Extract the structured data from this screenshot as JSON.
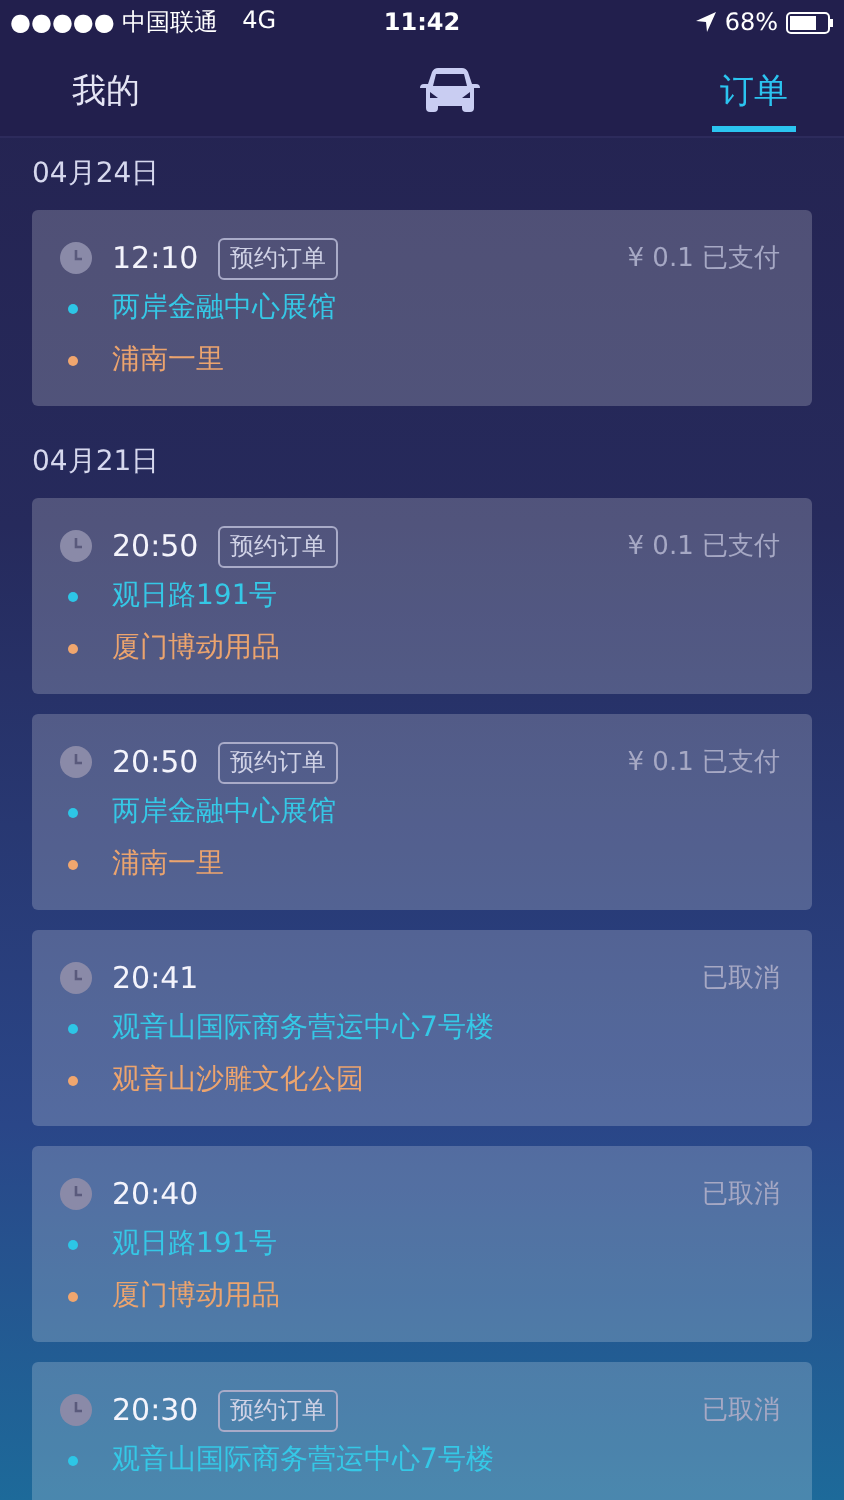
{
  "status_bar": {
    "carrier": "●●●●● 中国联通",
    "network": "4G",
    "time": "11:42",
    "battery": "68%"
  },
  "tabs": [
    {
      "label": "我的",
      "kind": "text",
      "selected": false
    },
    {
      "kind": "car",
      "selected": false
    },
    {
      "label": "订单",
      "kind": "text",
      "selected": true
    }
  ],
  "groups": [
    {
      "date": "04月24日",
      "orders": [
        {
          "time": "12:10",
          "reserved": true,
          "badge": "预约订单",
          "status": "¥ 0.1 已支付",
          "from": "两岸金融中心展馆",
          "to": "浦南一里"
        }
      ]
    },
    {
      "date": "04月21日",
      "orders": [
        {
          "time": "20:50",
          "reserved": true,
          "badge": "预约订单",
          "status": "¥ 0.1 已支付",
          "from": "观日路191号",
          "to": "厦门博动用品"
        },
        {
          "time": "20:50",
          "reserved": true,
          "badge": "预约订单",
          "status": "¥ 0.1 已支付",
          "from": "两岸金融中心展馆",
          "to": "浦南一里"
        },
        {
          "time": "20:41",
          "reserved": false,
          "status": "已取消",
          "from": "观音山国际商务营运中心7号楼",
          "to": "观音山沙雕文化公园"
        },
        {
          "time": "20:40",
          "reserved": false,
          "status": "已取消",
          "from": "观日路191号",
          "to": "厦门博动用品"
        },
        {
          "time": "20:30",
          "reserved": true,
          "badge": "预约订单",
          "status": "已取消",
          "from": "观音山国际商务营运中心7号楼"
        }
      ]
    }
  ]
}
